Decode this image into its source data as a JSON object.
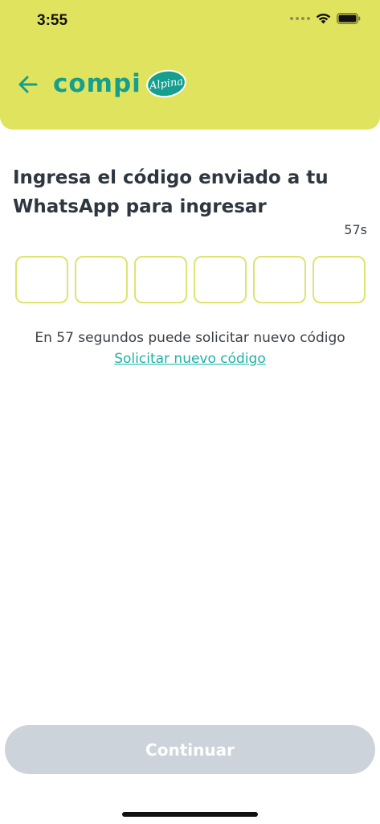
{
  "status_bar": {
    "time": "3:55"
  },
  "header": {
    "logo_text": "compi",
    "badge_text": "Alpina",
    "accent_color": "#dfe35d",
    "brand_color": "#159f8f"
  },
  "main": {
    "title": "Ingresa el código enviado a tu WhatsApp para ingresar",
    "timer": "57s",
    "otp_length": 6,
    "resend_info": "En 57 segundos puede solicitar nuevo código",
    "resend_link": "Solicitar nuevo código"
  },
  "footer": {
    "continue_label": "Continuar",
    "continue_disabled": true
  }
}
